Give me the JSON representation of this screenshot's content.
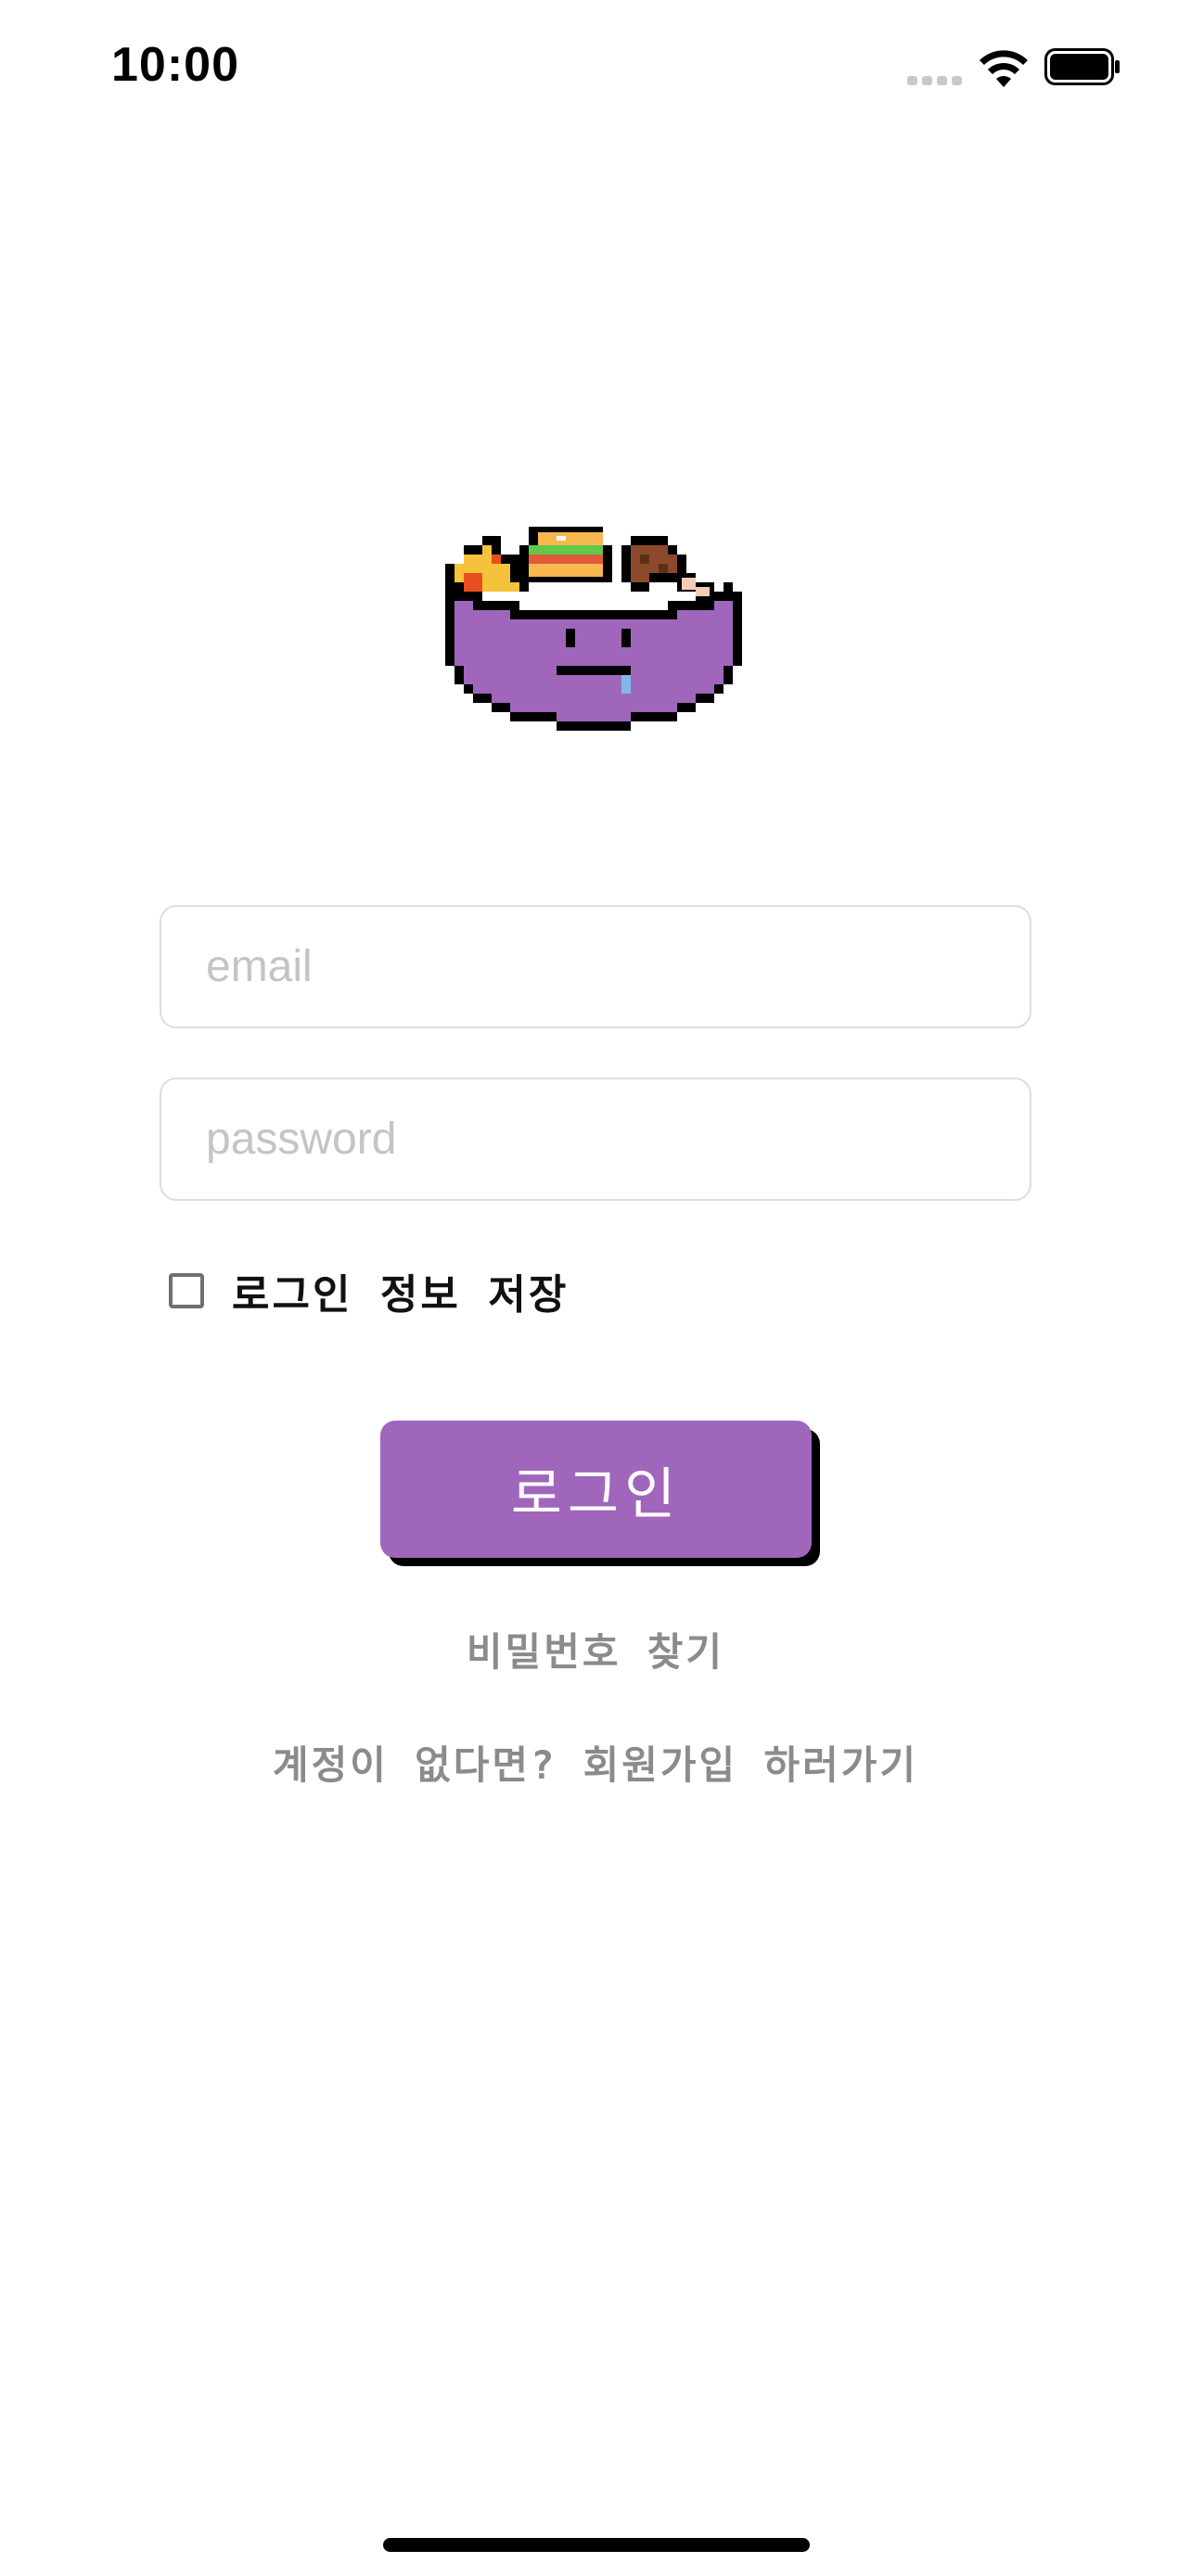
{
  "status_bar": {
    "time": "10:00",
    "icons": [
      "signal-icon",
      "wifi-icon",
      "battery-icon"
    ]
  },
  "logo": {
    "icon": "rice-bowl-character-logo",
    "colors": {
      "bowl": "#a066bb",
      "burger_bun": "#f7b84e",
      "lettuce": "#62c84a",
      "tomato": "#e25a3c",
      "meat": "#8b4a2b",
      "pizza": "#f5c23b"
    }
  },
  "login_form": {
    "email_placeholder": "email",
    "password_placeholder": "password",
    "email_value": "",
    "password_value": "",
    "remember_label": "로그인 정보 저장",
    "remember_checked": false,
    "login_button_label": "로그인",
    "find_password_label": "비밀번호 찾기",
    "signup_label": "계정이 없다면? 회원가입 하러가기"
  },
  "colors": {
    "accent": "#a066bb",
    "link_gray": "#8b8b8b",
    "input_border": "#dddddd"
  }
}
